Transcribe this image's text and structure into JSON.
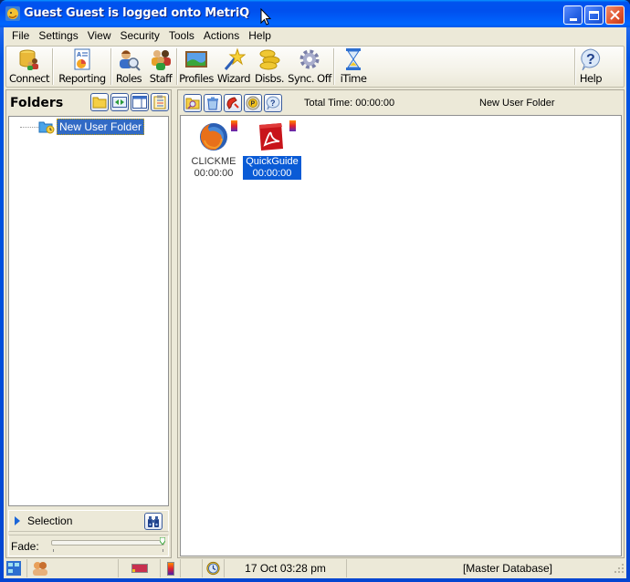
{
  "window": {
    "title": "Guest Guest is logged onto MetriQ",
    "controls": [
      "minimize",
      "maximize",
      "close"
    ]
  },
  "menu": [
    "File",
    "Settings",
    "View",
    "Security",
    "Tools",
    "Actions",
    "Help"
  ],
  "toolbar": {
    "buttons": [
      {
        "label": "Connect",
        "icon": "database-users-icon"
      },
      {
        "label": "Reporting",
        "icon": "report-icon"
      },
      {
        "label": "Roles",
        "icon": "role-search-icon"
      },
      {
        "label": "Staff",
        "icon": "staff-icon"
      },
      {
        "label": "Profiles",
        "icon": "landscape-picture-icon"
      },
      {
        "label": "Wizard",
        "icon": "magic-wand-icon"
      },
      {
        "label": "Disbs.",
        "icon": "coins-icon"
      },
      {
        "label": "Sync. Off",
        "icon": "gear-icon"
      },
      {
        "label": "iTime",
        "icon": "hourglass-icon"
      },
      {
        "label": "Help",
        "icon": "help-icon"
      }
    ]
  },
  "folders": {
    "title": "Folders",
    "header_icons": [
      "open-folder-icon",
      "split-arrows-icon",
      "panel-layout-icon",
      "clipboard-list-icon"
    ],
    "tree": [
      {
        "label": "New User Folder",
        "selected": true
      }
    ],
    "selection_label": "Selection",
    "fade_label": "Fade:",
    "fade_value": 1.0
  },
  "content_panel": {
    "toolbar_icons": [
      "folder-search-icon",
      "bin-icon",
      "phone-icon",
      "parking-icon",
      "help-bubble-icon"
    ],
    "total_time_label": "Total Time: 00:00:00",
    "folder_name": "New User Folder",
    "items": [
      {
        "name": "CLICKME",
        "time": "00:00:00",
        "icon": "firefox-icon",
        "selected": false
      },
      {
        "name": "QuickGuide",
        "time": "00:00:00",
        "icon": "pdf-icon",
        "selected": true
      }
    ]
  },
  "statusbar": {
    "datetime": "17 Oct 03:28 pm",
    "database": "[Master Database]"
  },
  "colors": {
    "title_bar": "#0054e3",
    "selection": "#316ac5",
    "item_selection": "#0a5bd6",
    "panel_bg": "#ece9d8"
  }
}
